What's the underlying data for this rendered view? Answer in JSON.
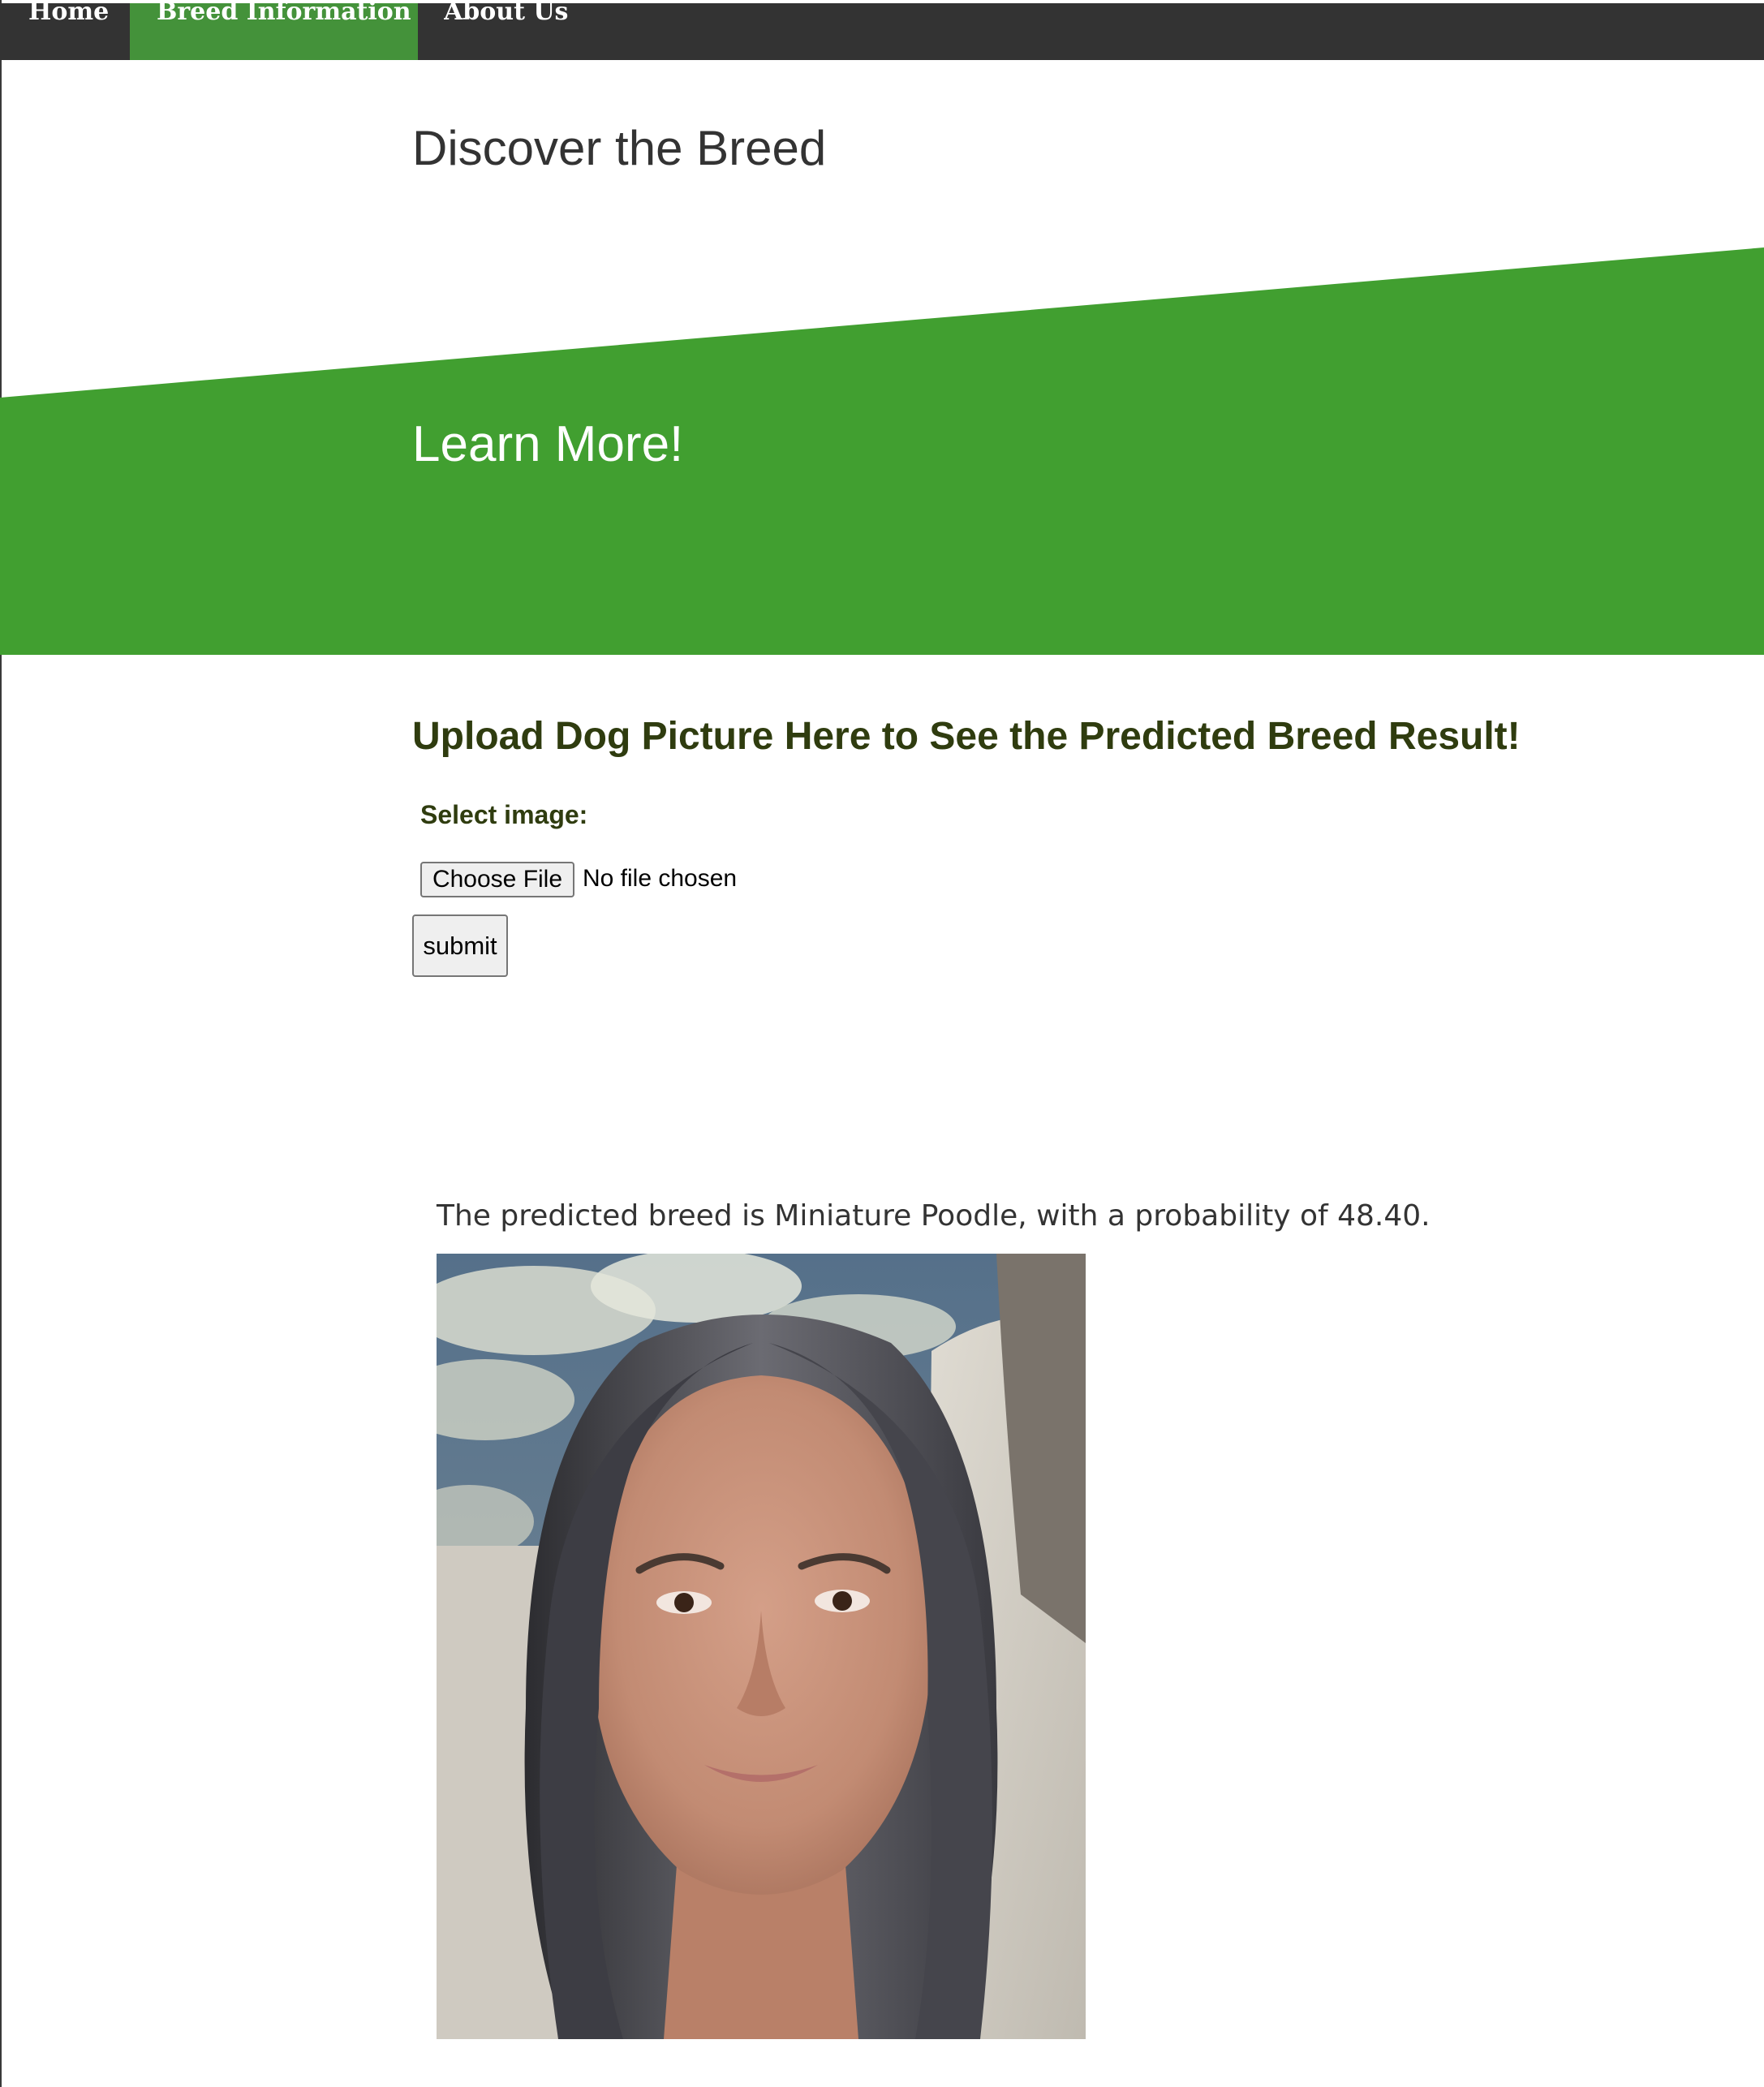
{
  "nav": {
    "items": [
      {
        "label": "Home",
        "active": false
      },
      {
        "label": "Breed Information",
        "active": true
      },
      {
        "label": "About Us",
        "active": false
      }
    ]
  },
  "page": {
    "title": "Discover the Breed"
  },
  "banner": {
    "text": "Learn More!"
  },
  "upload": {
    "heading": "Upload Dog Picture Here to See the Predicted Breed Result!",
    "select_label": "Select image:",
    "file_button_label": "Choose File",
    "file_status": "No file chosen",
    "submit_label": "submit"
  },
  "result": {
    "text": "The predicted breed is Miniature Poodle, with a probability of 48.40.",
    "image": "uploaded-photo"
  },
  "colors": {
    "nav_background": "#333333",
    "nav_active": "#44923a",
    "banner_green": "#419f30",
    "heading_dark_olive": "#2f3c0f",
    "text_dark": "#333333"
  }
}
